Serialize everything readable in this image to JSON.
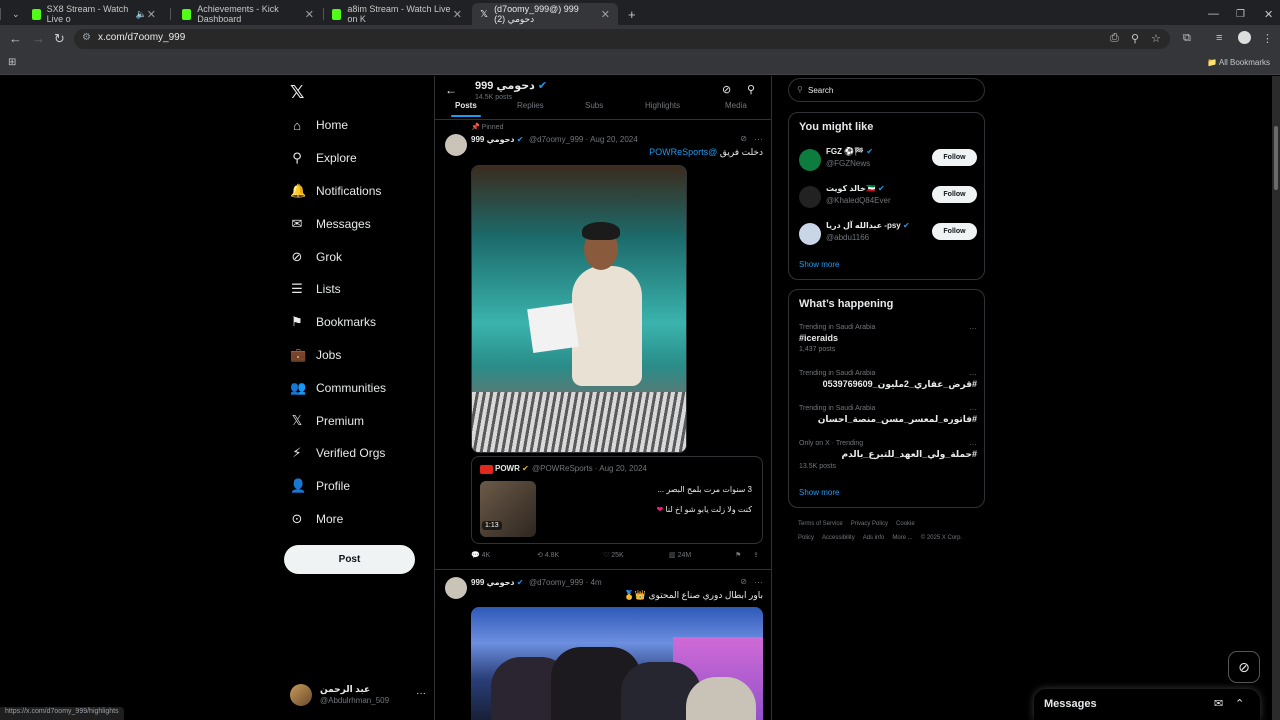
{
  "browser": {
    "tabs": [
      {
        "label": "SX8 Stream - Watch Live o",
        "icon": "kick-icon",
        "muted": "speaker-icon"
      },
      {
        "label": "Achievements - Kick Dashboard",
        "icon": "kick-icon"
      },
      {
        "label": "a8im Stream - Watch Live on K",
        "icon": "kick-icon"
      },
      {
        "label": "(d7oomy_999@) 999 دحومي (2)",
        "icon": "x-icon"
      }
    ],
    "new_tab": "+",
    "url": "x.com/d7oomy_999",
    "bookmarks_label": "All Bookmarks"
  },
  "sidebar": {
    "logo": "𝕏",
    "items": [
      {
        "label": "Home",
        "icon": "home-icon",
        "glyph": "⌂"
      },
      {
        "label": "Explore",
        "icon": "search-icon",
        "glyph": "⚲"
      },
      {
        "label": "Notifications",
        "icon": "bell-icon",
        "glyph": "🔔"
      },
      {
        "label": "Messages",
        "icon": "envelope-icon",
        "glyph": "✉"
      },
      {
        "label": "Grok",
        "icon": "grok-icon",
        "glyph": "⊘"
      },
      {
        "label": "Lists",
        "icon": "list-icon",
        "glyph": "☰"
      },
      {
        "label": "Bookmarks",
        "icon": "bookmark-icon",
        "glyph": "⚑"
      },
      {
        "label": "Jobs",
        "icon": "briefcase-icon",
        "glyph": "💼"
      },
      {
        "label": "Communities",
        "icon": "people-icon",
        "glyph": "👥"
      },
      {
        "label": "Premium",
        "icon": "x-icon",
        "glyph": "𝕏"
      },
      {
        "label": "Verified Orgs",
        "icon": "lightning-icon",
        "glyph": "⚡"
      },
      {
        "label": "Profile",
        "icon": "person-icon",
        "glyph": "👤"
      },
      {
        "label": "More",
        "icon": "more-circle-icon",
        "glyph": "⊙"
      }
    ],
    "post_label": "Post",
    "account": {
      "name": "عبد الرحمن",
      "handle": "@Abdulrhman_509"
    }
  },
  "profile_header": {
    "name": "999 دحومي",
    "posts": "14.5K posts",
    "tabs": [
      "Posts",
      "Replies",
      "Subs",
      "Highlights",
      "Media"
    ]
  },
  "tweets": [
    {
      "pinned": "Pinned",
      "name": "999 دحومي",
      "handle": "@d7oomy_999",
      "date": "· Aug 20, 2024",
      "text": "دخلت فريق",
      "mention": "@POWReSports",
      "quote": {
        "name": "POWR",
        "handle": "@POWReSports · Aug 20, 2024",
        "line1": "3 سنوات مرت بلمح البصر ...",
        "line2": "كنت ولا زلت يابو شو اخ لنا",
        "duration": "1:13"
      },
      "stats": {
        "replies": "4K",
        "reposts": "4.8K",
        "likes": "25K",
        "views": "24M"
      }
    },
    {
      "name": "999 دحومي",
      "handle": "@d7oomy_999 · 4m",
      "text": "باور ابطال دوري صناع المحتوى 👑🥇"
    }
  ],
  "right": {
    "search_placeholder": "Search",
    "you_might_like": {
      "title": "You might like",
      "users": [
        {
          "name": "FGZ ⚽️🏁",
          "handle": "@FGZNews",
          "follow": "Follow",
          "color": "#0d7c3e"
        },
        {
          "name": "خالد كويت🇰🇼",
          "handle": "@KhaledQ84Ever",
          "follow": "Follow",
          "color": "#222"
        },
        {
          "name": "عبدالله آل دريا -psy",
          "handle": "@abdu1166",
          "follow": "Follow",
          "color": "#c8d6e8"
        }
      ],
      "show_more": "Show more"
    },
    "whats_happening": {
      "title": "What’s happening",
      "trends": [
        {
          "meta": "Trending in Saudi Arabia",
          "name": "#iceraids",
          "count": "1,437 posts",
          "rtl": false
        },
        {
          "meta": "Trending in Saudi Arabia",
          "name": "#قرض_عقاري_2مليون_0539769609",
          "count": "",
          "rtl": true
        },
        {
          "meta": "Trending in Saudi Arabia",
          "name": "#فاتوره_لمعسر_مسن_منصة_احسان",
          "count": "",
          "rtl": true
        },
        {
          "meta": "Only on X · Trending",
          "name": "#حملة_ولي_العهد_للتبرع_بالدم",
          "count": "13.5K posts",
          "rtl": true
        }
      ],
      "show_more": "Show more"
    },
    "footer": [
      "Terms of Service",
      "Privacy Policy",
      "Cookie Policy",
      "Accessibility",
      "Ads info",
      "More ...",
      "© 2025 X Corp."
    ]
  },
  "messages_drawer": {
    "title": "Messages"
  },
  "status_url": "https://x.com/d7oomy_999/highlights"
}
